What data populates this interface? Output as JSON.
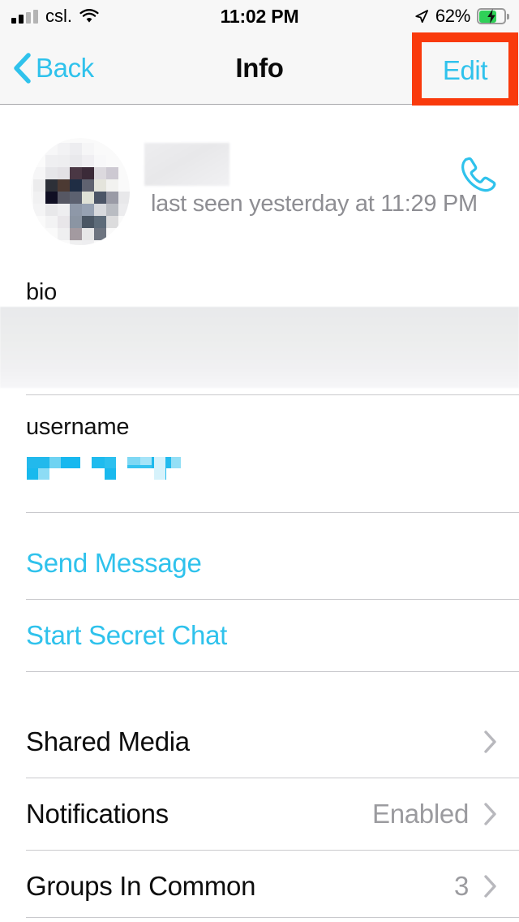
{
  "status_bar": {
    "carrier": "csl.",
    "time": "11:02 PM",
    "battery_percent": "62%",
    "signal_icon": "signal-bars-icon",
    "wifi_icon": "wifi-icon",
    "location_icon": "location-arrow-icon",
    "battery_icon": "battery-charging-icon",
    "battery_level": 62,
    "charging": true
  },
  "nav_bar": {
    "back_label": "Back",
    "back_icon": "chevron-left-icon",
    "title": "Info",
    "edit_label": "Edit",
    "highlight_color": "#f93a0c"
  },
  "contact": {
    "avatar_icon": "avatar-pixelated-image",
    "name_redacted": true,
    "status_text": "last seen yesterday at 11:29 PM",
    "call_icon": "phone-call-icon"
  },
  "fields": {
    "bio_label": "bio",
    "bio_redacted": true,
    "username_label": "username",
    "username_redacted": true
  },
  "actions": [
    {
      "label": "Send Message",
      "name": "send-message-button"
    },
    {
      "label": "Start Secret Chat",
      "name": "start-secret-chat-button"
    }
  ],
  "settings_rows": [
    {
      "title": "Shared Media",
      "value": "",
      "name": "shared-media-row"
    },
    {
      "title": "Notifications",
      "value": "Enabled",
      "name": "notifications-row"
    },
    {
      "title": "Groups In Common",
      "value": "3",
      "name": "groups-in-common-row"
    }
  ],
  "colors": {
    "accent": "#2fc2ec",
    "highlight": "#f93a0c",
    "secondary_text": "#8e8e93",
    "chevron": "#b8b8bd"
  }
}
